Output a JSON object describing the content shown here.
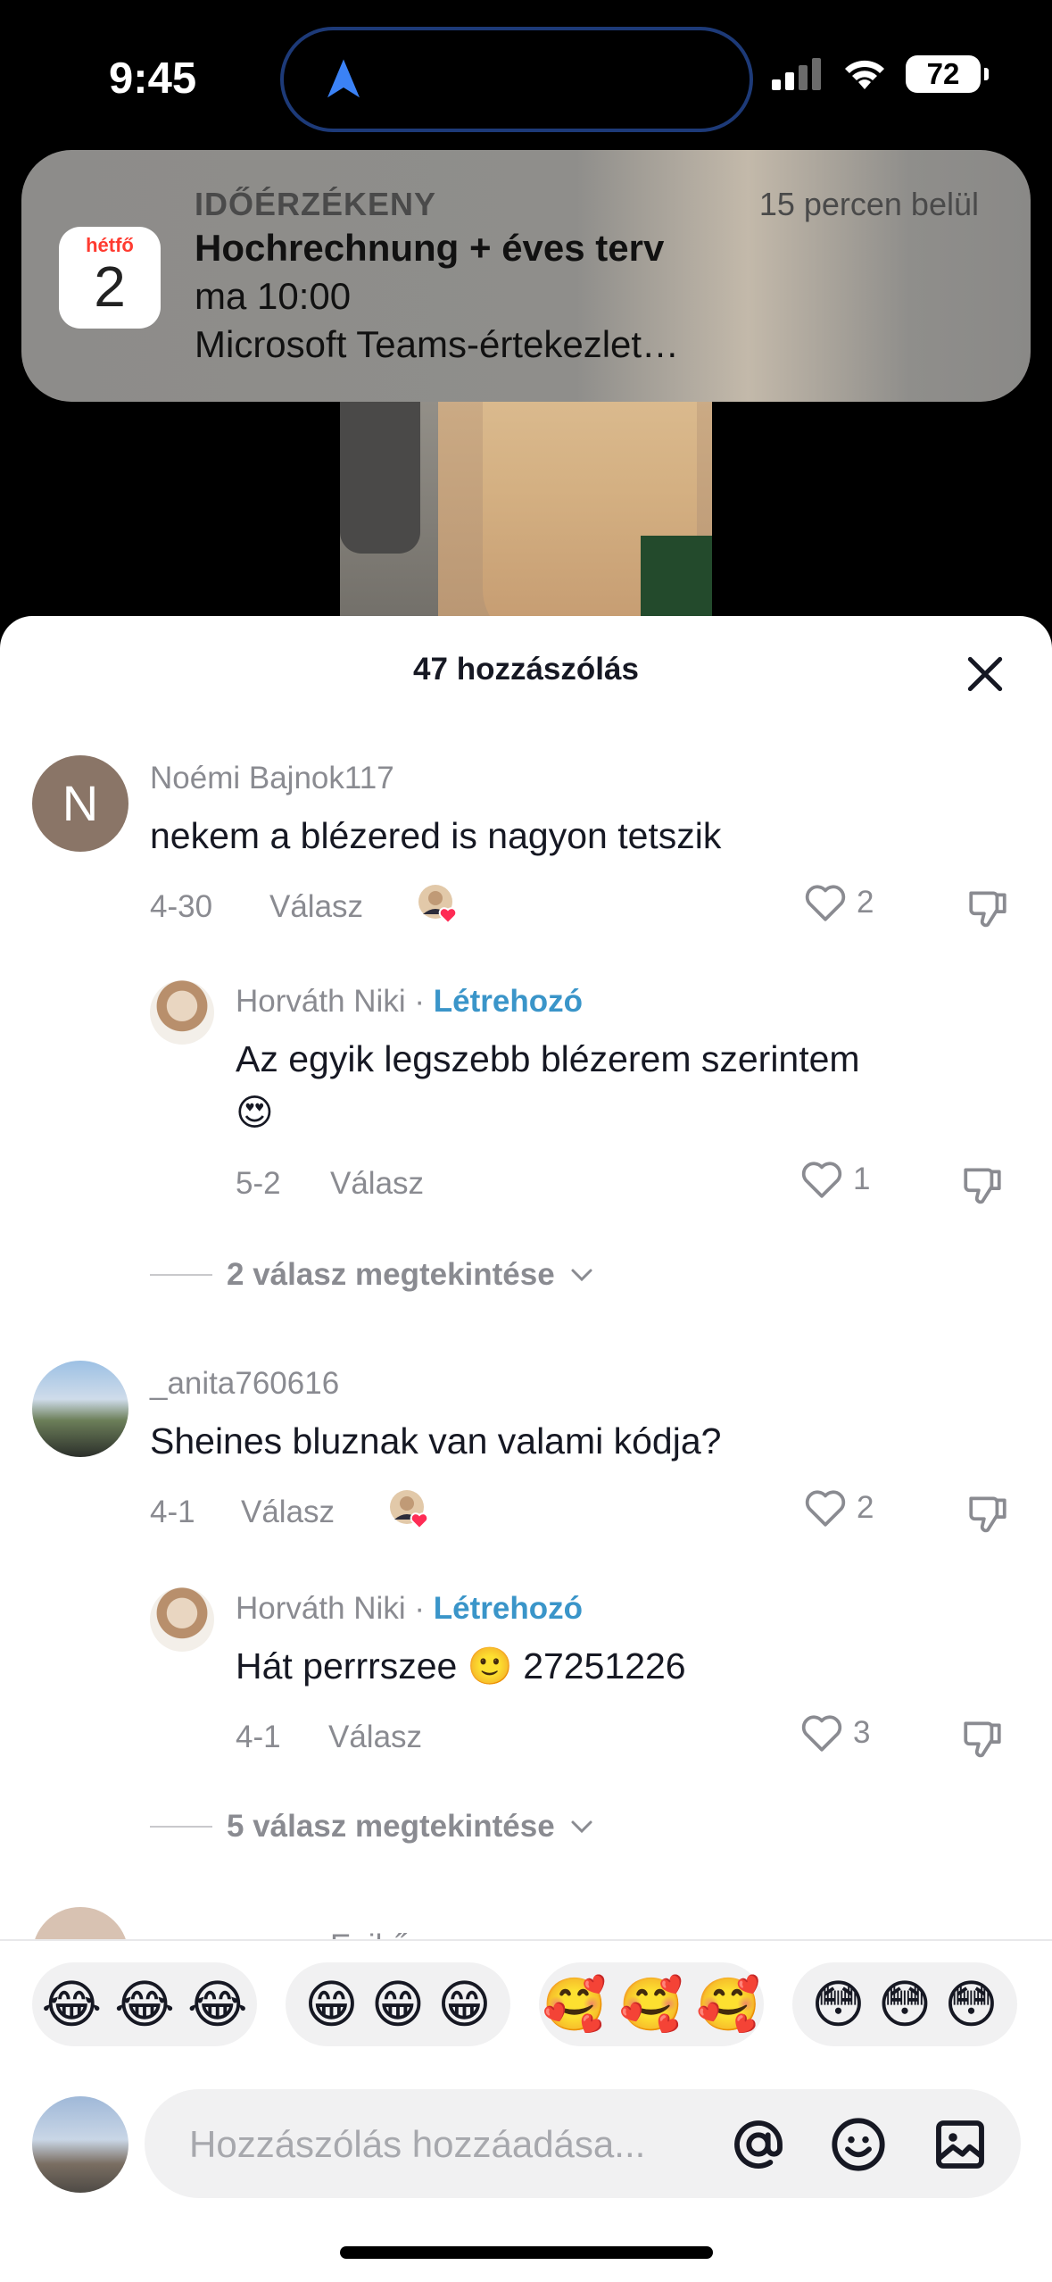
{
  "status": {
    "time": "9:45",
    "battery": "72"
  },
  "notification": {
    "app": "IDŐÉRZÉKENY",
    "when": "15 percen belül",
    "cal_day": "hétfő",
    "cal_num": "2",
    "title": "Hochrechnung + éves terv",
    "line1": "ma 10:00",
    "line2": "Microsoft Teams-értekezlet…"
  },
  "sheet": {
    "title": "47 hozzászólás"
  },
  "comments": [
    {
      "avatar_letter": "N",
      "username": "Noémi Bajnok117",
      "text": "nekem a blézered is nagyon tetszik",
      "date": "4-30",
      "reply_label": "Válasz",
      "likes": "2",
      "reply": {
        "username": "Horváth Niki",
        "badge": "Létrehozó",
        "text_line1": "Az egyik legszebb blézerem szerintem",
        "text_line2": "😍",
        "date": "5-2",
        "reply_label": "Válasz",
        "likes": "1"
      },
      "view_replies": "2 válasz megtekintése"
    },
    {
      "username": "_anita760616",
      "text": "Sheines bluznak van valami kódja?",
      "date": "4-1",
      "reply_label": "Válasz",
      "likes": "2",
      "reply": {
        "username": "Horváth Niki",
        "badge": "Létrehozó",
        "text_line1": "Hát perrrszee 🙂 27251226",
        "date": "4-1",
        "reply_label": "Válasz",
        "likes": "3"
      },
      "view_replies": "5 válasz megtekintése"
    }
  ],
  "partial_comment": {
    "username": "Enikő"
  },
  "quick_emojis": [
    {
      "emoji": "😂"
    },
    {
      "emoji": "😁"
    },
    {
      "emoji": "🥰"
    },
    {
      "emoji": "😳"
    }
  ],
  "input": {
    "placeholder": "Hozzászólás hozzáadása..."
  },
  "separator": "·"
}
